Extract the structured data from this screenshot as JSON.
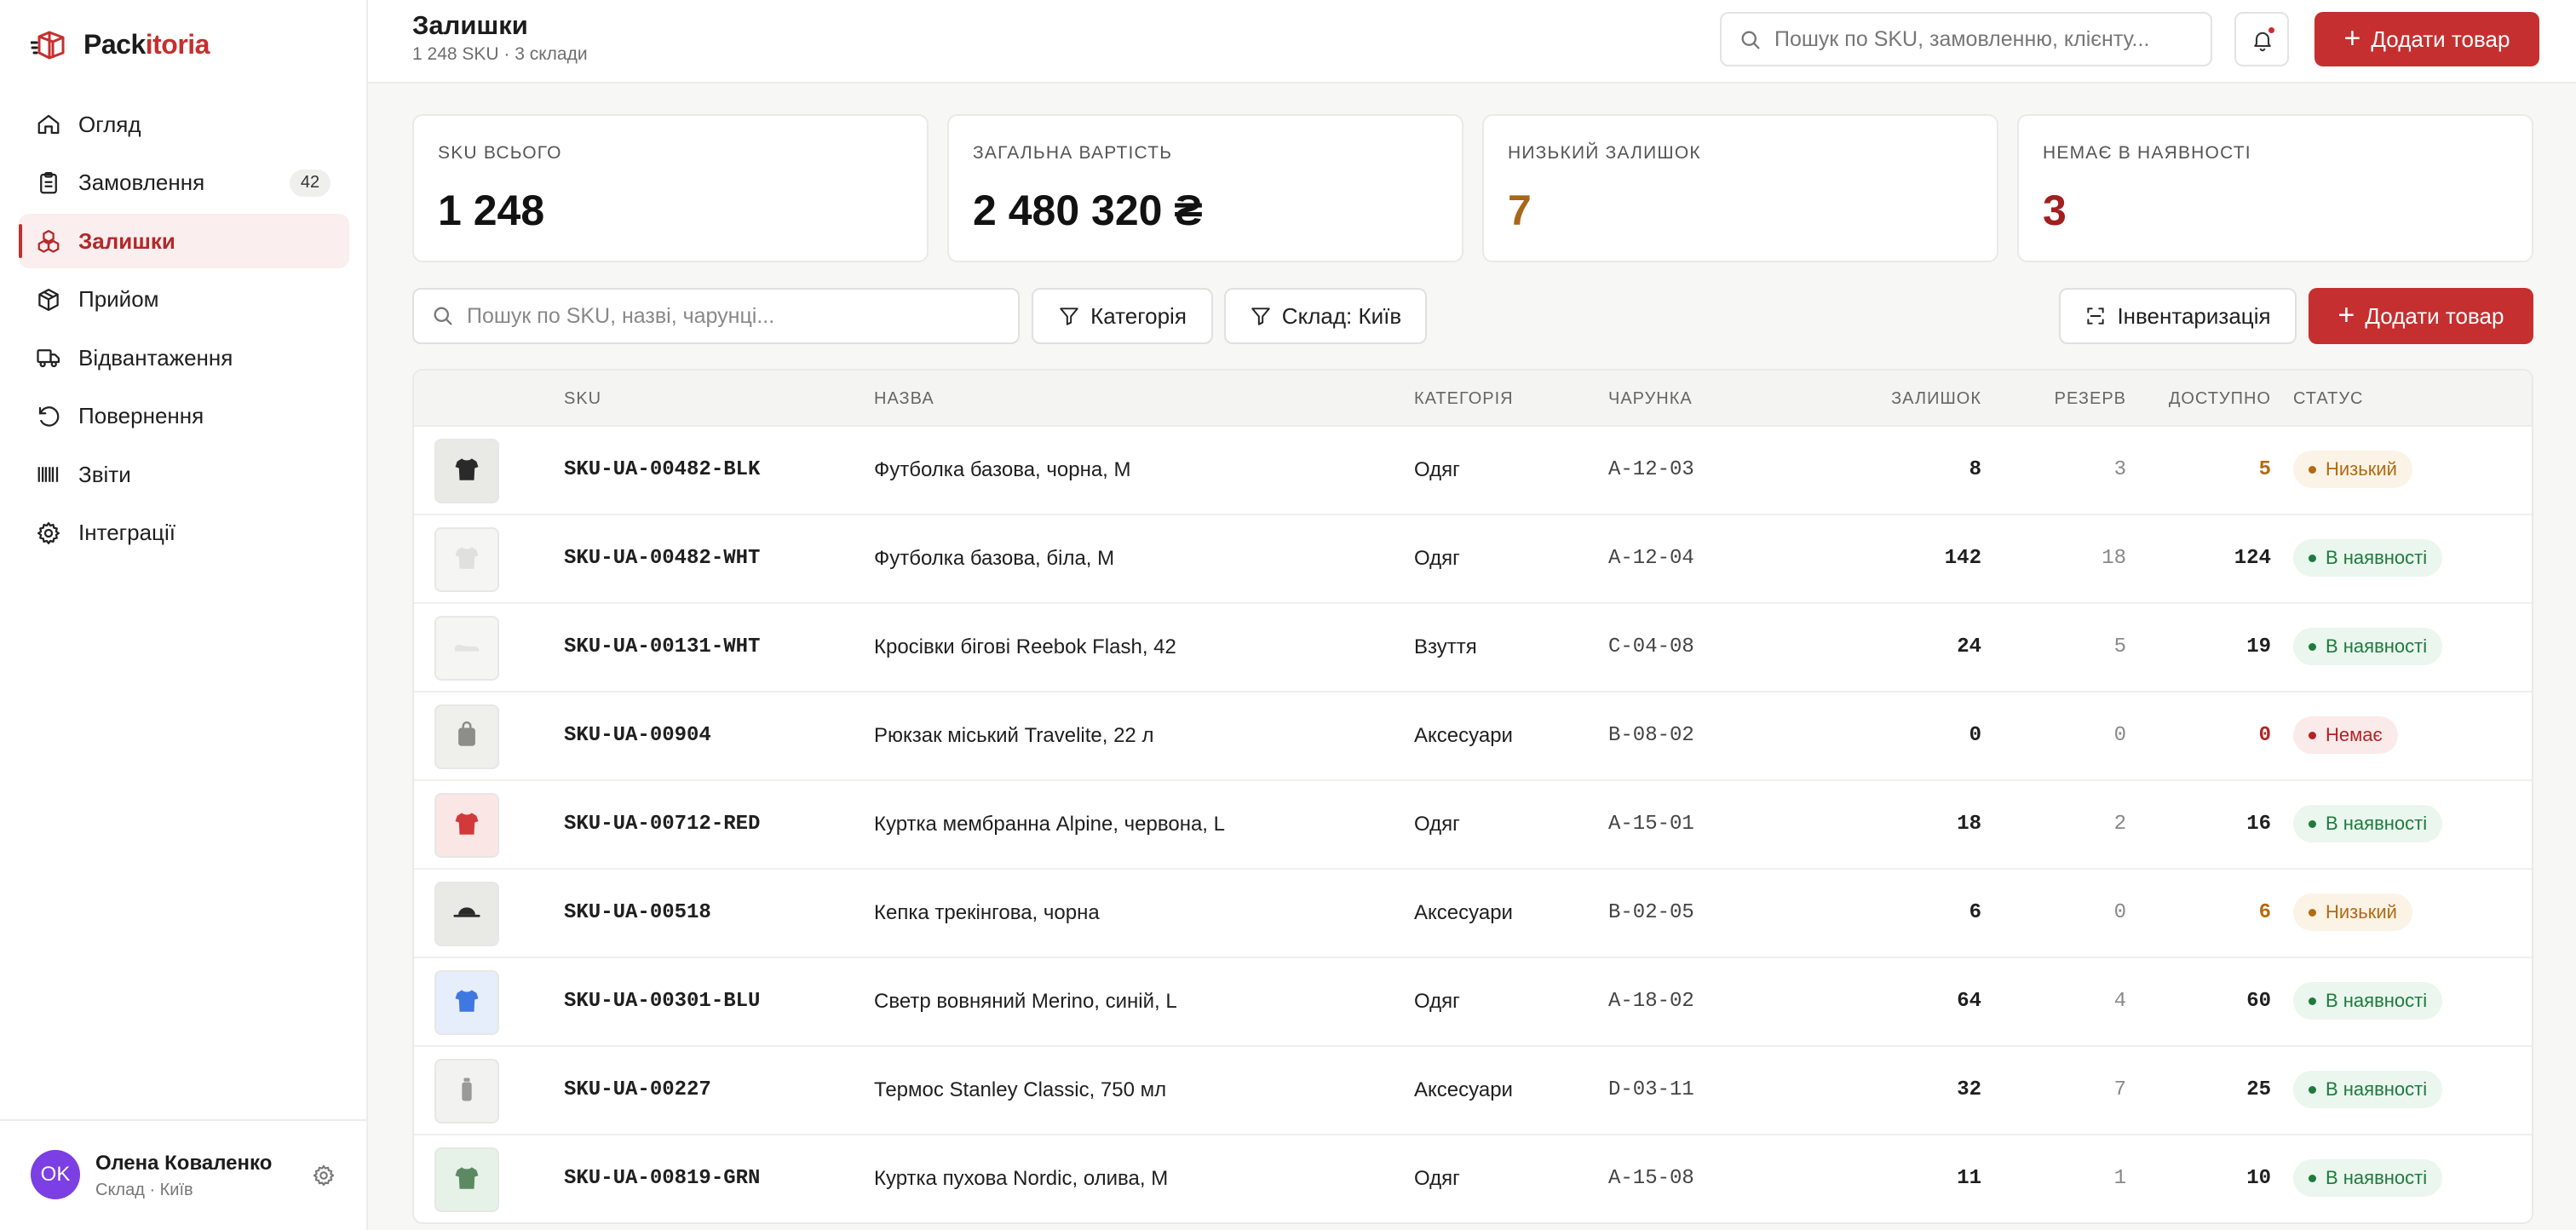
{
  "brand": {
    "part1": "Pack",
    "part2": "itoria",
    "accent": "#c62f2f"
  },
  "sidebar": {
    "items": [
      {
        "label": "Огляд",
        "icon": "home-icon"
      },
      {
        "label": "Замовлення",
        "icon": "clipboard-icon",
        "badge": "42"
      },
      {
        "label": "Залишки",
        "icon": "boxes-icon",
        "active": true
      },
      {
        "label": "Прийом",
        "icon": "package-icon"
      },
      {
        "label": "Відвантаження",
        "icon": "truck-icon"
      },
      {
        "label": "Повернення",
        "icon": "rotate-ccw-icon"
      },
      {
        "label": "Звіти",
        "icon": "barcode-icon"
      },
      {
        "label": "Інтеграції",
        "icon": "gear-icon"
      }
    ],
    "user": {
      "initials": "OK",
      "name": "Олена Коваленко",
      "role": "Склад · Київ"
    }
  },
  "header": {
    "title": "Залишки",
    "subtitle": "1 248 SKU · 3 склади",
    "search_placeholder": "Пошук по SKU, замовленню, клієнту...",
    "add_label": "Додати товар"
  },
  "kpis": [
    {
      "label": "SKU ВСЬОГО",
      "value": "1 248",
      "color": "#121212"
    },
    {
      "label": "ЗАГАЛЬНА ВАРТІСТЬ",
      "value": "2 480 320 ₴",
      "color": "#121212"
    },
    {
      "label": "НИЗЬКИЙ ЗАЛИШОК",
      "value": "7",
      "color": "#a8661a"
    },
    {
      "label": "НЕМАЄ В НАЯВНОСТІ",
      "value": "3",
      "color": "#a21f1f"
    }
  ],
  "toolbar": {
    "search_placeholder": "Пошук по SKU, назві, чарунці...",
    "category_label": "Категорія",
    "warehouse_label": "Склад: Київ",
    "inventory_label": "Інвентаризація",
    "add_label": "Додати товар"
  },
  "table": {
    "columns": [
      "SKU",
      "НАЗВА",
      "КАТЕГОРІЯ",
      "ЧАРУНКА",
      "ЗАЛИШОК",
      "РЕЗЕРВ",
      "ДОСТУПНО",
      "СТАТУС"
    ],
    "rows": [
      {
        "sku": "SKU-UA-00482-BLK",
        "name": "Футболка базова, чорна, M",
        "category": "Одяг",
        "cell": "A-12-03",
        "stock": "8",
        "reserve": "3",
        "available": "5",
        "status": "Низький",
        "status_kind": "low",
        "thumb": "tshirt-icon",
        "thumb_bg": "#e9e9e6",
        "thumb_fg": "#2a2a2a"
      },
      {
        "sku": "SKU-UA-00482-WHT",
        "name": "Футболка базова, біла, M",
        "category": "Одяг",
        "cell": "A-12-04",
        "stock": "142",
        "reserve": "18",
        "available": "124",
        "status": "В наявності",
        "status_kind": "ok",
        "thumb": "tshirt-icon",
        "thumb_bg": "#f5f5f4",
        "thumb_fg": "#e0e0de"
      },
      {
        "sku": "SKU-UA-00131-WHT",
        "name": "Кросівки бігові Reebok Flash, 42",
        "category": "Взуття",
        "cell": "C-04-08",
        "stock": "24",
        "reserve": "5",
        "available": "19",
        "status": "В наявності",
        "status_kind": "ok",
        "thumb": "shoe-icon",
        "thumb_bg": "#f5f5f4",
        "thumb_fg": "#e3e3e1"
      },
      {
        "sku": "SKU-UA-00904",
        "name": "Рюкзак міський Travelite, 22 л",
        "category": "Аксесуари",
        "cell": "B-08-02",
        "stock": "0",
        "reserve": "0",
        "available": "0",
        "status": "Немає",
        "status_kind": "out",
        "thumb": "backpack-icon",
        "thumb_bg": "#efefec",
        "thumb_fg": "#8d8d8a"
      },
      {
        "sku": "SKU-UA-00712-RED",
        "name": "Куртка мембранна Alpine, червона, L",
        "category": "Одяг",
        "cell": "A-15-01",
        "stock": "18",
        "reserve": "2",
        "available": "16",
        "status": "В наявності",
        "status_kind": "ok",
        "thumb": "tshirt-icon",
        "thumb_bg": "#fbe6e6",
        "thumb_fg": "#d23a3a"
      },
      {
        "sku": "SKU-UA-00518",
        "name": "Кепка трекінгова, чорна",
        "category": "Аксесуари",
        "cell": "B-02-05",
        "stock": "6",
        "reserve": "0",
        "available": "6",
        "status": "Низький",
        "status_kind": "low",
        "thumb": "cap-icon",
        "thumb_bg": "#e9e9e6",
        "thumb_fg": "#2a2a2a"
      },
      {
        "sku": "SKU-UA-00301-BLU",
        "name": "Светр вовняний Merino, синій, L",
        "category": "Одяг",
        "cell": "A-18-02",
        "stock": "64",
        "reserve": "4",
        "available": "60",
        "status": "В наявності",
        "status_kind": "ok",
        "thumb": "tshirt-icon",
        "thumb_bg": "#e6eefb",
        "thumb_fg": "#3f78e0"
      },
      {
        "sku": "SKU-UA-00227",
        "name": "Термос Stanley Classic, 750 мл",
        "category": "Аксесуари",
        "cell": "D-03-11",
        "stock": "32",
        "reserve": "7",
        "available": "25",
        "status": "В наявності",
        "status_kind": "ok",
        "thumb": "bottle-icon",
        "thumb_bg": "#f2f2f0",
        "thumb_fg": "#9a9a97"
      },
      {
        "sku": "SKU-UA-00819-GRN",
        "name": "Куртка пухова Nordic, олива, M",
        "category": "Одяг",
        "cell": "A-15-08",
        "stock": "11",
        "reserve": "1",
        "available": "10",
        "status": "В наявності",
        "status_kind": "ok",
        "thumb": "tshirt-icon",
        "thumb_bg": "#e6f1e8",
        "thumb_fg": "#5b8a62"
      }
    ]
  },
  "colors": {
    "low": "#b36a10",
    "ok": "#1f7a3d",
    "out": "#b52222"
  }
}
